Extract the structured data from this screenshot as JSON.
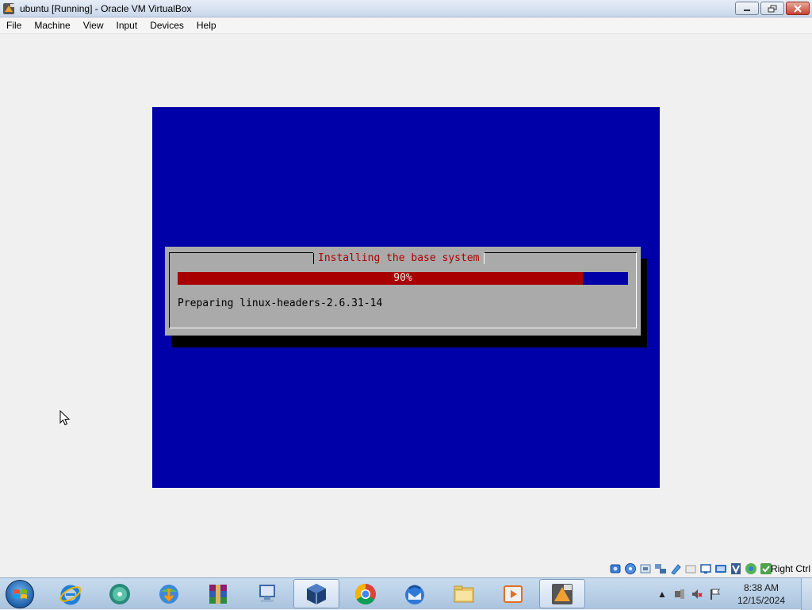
{
  "window": {
    "title": "ubuntu [Running] - Oracle VM VirtualBox"
  },
  "menu": {
    "items": [
      {
        "label": "File"
      },
      {
        "label": "Machine"
      },
      {
        "label": "View"
      },
      {
        "label": "Input"
      },
      {
        "label": "Devices"
      },
      {
        "label": "Help"
      }
    ]
  },
  "installer": {
    "dialog_title": "Installing the base system",
    "progress_fraction": 0.9,
    "progress_label": "90%",
    "status_message": "Preparing linux-headers-2.6.31-14"
  },
  "statusbar": {
    "host_key_label": "Right Ctrl",
    "icons": [
      "hard-disk-icon",
      "optical-drive-icon",
      "audio-icon",
      "network-icon",
      "usb-icon",
      "shared-folders-icon",
      "display-icon",
      "recording-icon",
      "vt-x-icon",
      "mouse-integration-icon",
      "host-key-icon"
    ]
  },
  "taskbar": {
    "apps": [
      {
        "name": "internet-explorer",
        "active": false
      },
      {
        "name": "cd-burner",
        "active": false
      },
      {
        "name": "internet-download-manager",
        "active": false
      },
      {
        "name": "winrar",
        "active": false
      },
      {
        "name": "remote-desktop",
        "active": false
      },
      {
        "name": "virtualbox",
        "active": true
      },
      {
        "name": "chrome",
        "active": false
      },
      {
        "name": "thunderbird",
        "active": false
      },
      {
        "name": "file-explorer",
        "active": false
      },
      {
        "name": "media-player",
        "active": false
      },
      {
        "name": "ubuntu-vm",
        "active": true
      }
    ],
    "clock_time": "8:38 AM",
    "clock_date": "12/15/2024"
  },
  "colors": {
    "vm_background": "#0000a8",
    "dialog_background": "#aaaaaa",
    "progress_fill": "#a80000",
    "dialog_title": "#a80000"
  }
}
